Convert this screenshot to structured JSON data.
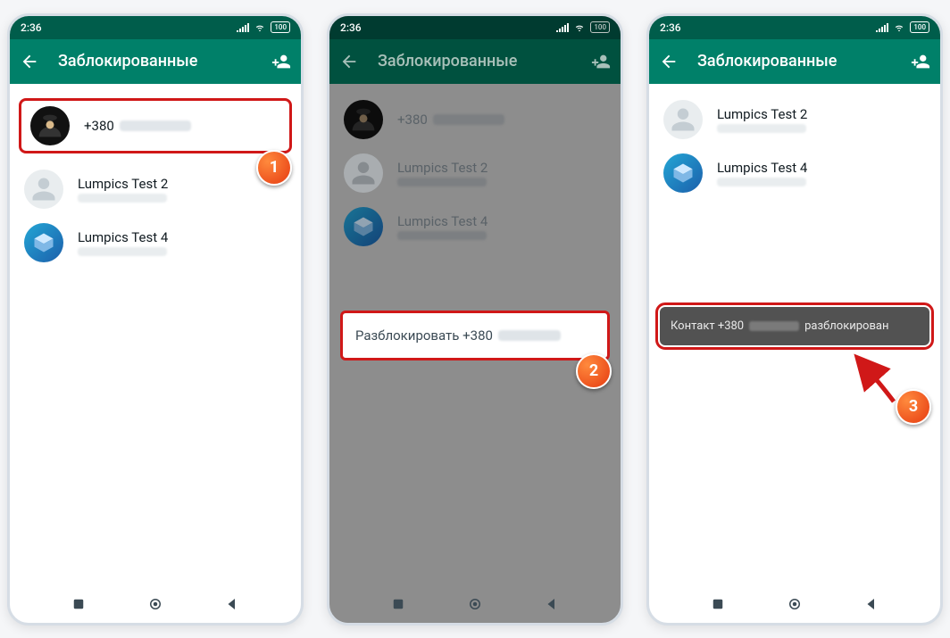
{
  "status": {
    "time": "2:36",
    "battery": "100"
  },
  "header": {
    "title": "Заблокированные"
  },
  "screen1": {
    "rows": [
      {
        "name": "+380"
      },
      {
        "name": "Lumpics Test 2"
      },
      {
        "name": "Lumpics Test 4"
      }
    ]
  },
  "screen2": {
    "rows": [
      {
        "name": "+380"
      },
      {
        "name": "Lumpics Test 2"
      },
      {
        "name": "Lumpics Test 4"
      }
    ],
    "action_prefix": "Разблокировать +380"
  },
  "screen3": {
    "rows": [
      {
        "name": "Lumpics Test 2"
      },
      {
        "name": "Lumpics Test 4"
      }
    ],
    "toast_prefix": "Контакт +380",
    "toast_suffix": "разблокирован"
  },
  "badges": {
    "one": "1",
    "two": "2",
    "three": "3"
  }
}
